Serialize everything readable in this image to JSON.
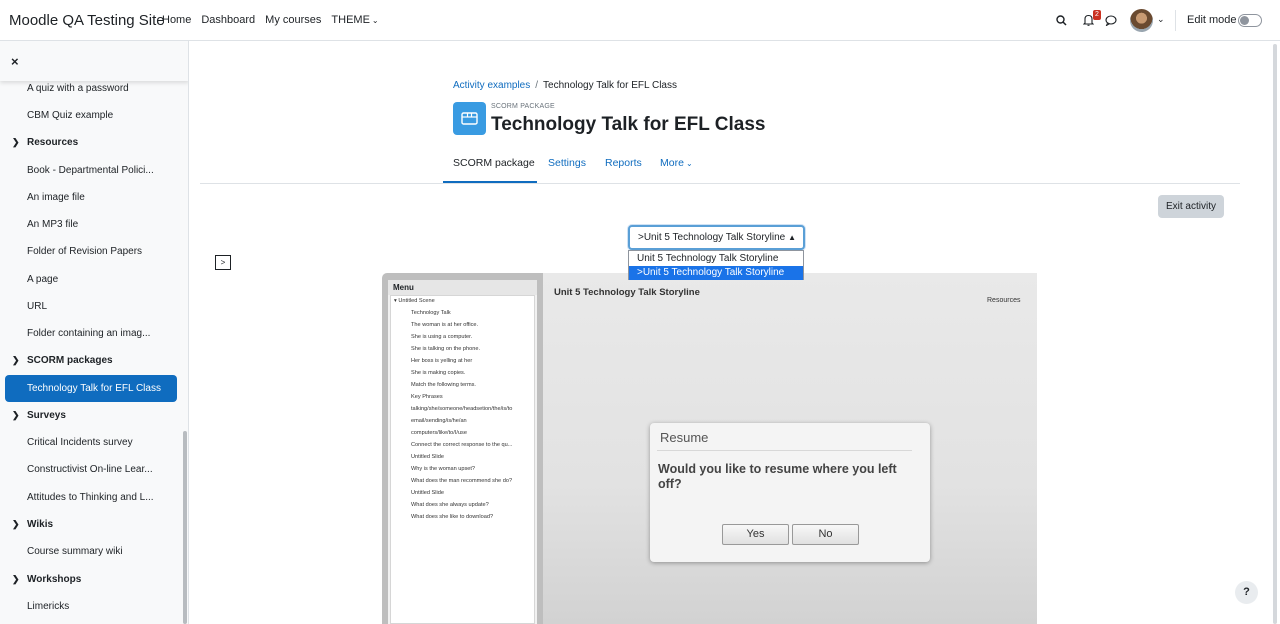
{
  "site": {
    "name": "Moodle QA Testing Site"
  },
  "nav": {
    "home": "Home",
    "dashboard": "Dashboard",
    "my_courses": "My courses",
    "theme": "THEME"
  },
  "header": {
    "notifications_count": "2",
    "edit_mode_label": "Edit mode"
  },
  "sidebar": {
    "close": "×",
    "items": [
      {
        "label": "A quiz with a password"
      },
      {
        "label": "CBM Quiz example"
      },
      {
        "label": "Resources",
        "section": true
      },
      {
        "label": "Book - Departmental Polici..."
      },
      {
        "label": "An image file"
      },
      {
        "label": "An MP3 file"
      },
      {
        "label": "Folder of Revision Papers"
      },
      {
        "label": "A page"
      },
      {
        "label": "URL"
      },
      {
        "label": "Folder containing an imag..."
      },
      {
        "label": "SCORM packages",
        "section": true
      },
      {
        "label": "Technology Talk for EFL Class",
        "active": true
      },
      {
        "label": "Surveys",
        "section": true
      },
      {
        "label": "Critical Incidents survey"
      },
      {
        "label": "Constructivist On-line Lear..."
      },
      {
        "label": "Attitudes to Thinking and L..."
      },
      {
        "label": "Wikis",
        "section": true
      },
      {
        "label": "Course summary wiki"
      },
      {
        "label": "Workshops",
        "section": true
      },
      {
        "label": "Limericks"
      }
    ]
  },
  "breadcrumb": {
    "parent": "Activity examples",
    "current": "Technology Talk for EFL Class"
  },
  "page": {
    "module_type": "SCORM PACKAGE",
    "title": "Technology Talk for EFL Class"
  },
  "tabs": [
    {
      "label": "SCORM package",
      "active": true
    },
    {
      "label": "Settings"
    },
    {
      "label": "Reports"
    },
    {
      "label": "More"
    }
  ],
  "exit_button": "Exit activity",
  "toc_toggle": ">",
  "sco_select": {
    "value": ">Unit 5 Technology Talk Storyline",
    "options": [
      "Unit 5 Technology Talk Storyline",
      ">Unit 5 Technology Talk Storyline"
    ],
    "selected_index": 1
  },
  "player": {
    "menu_title": "Menu",
    "scene": "Untitled Scene",
    "menu_items": [
      "Technology Talk",
      "The woman is at her office.",
      "She is using a computer.",
      "She is talking on the phone.",
      "Her boss is yelling at her",
      "She is making copies.",
      "Match the following terms.",
      "Key Phrases",
      "talking/she/someone/headsetion/the/is/to",
      "email/sending/is/he/an",
      "computers/like/to/I/use",
      "Connect the correct response to the qu...",
      "Untitled Slide",
      "Why is the woman upset?",
      "What does the man recommend she do?",
      "Untitled Slide",
      "What does she always update?",
      "What does she like to download?"
    ],
    "slide_title": "Unit 5 Technology Talk Storyline",
    "resources": "Resources"
  },
  "dialog": {
    "title": "Resume",
    "question": "Would you like to resume where you left off?",
    "yes": "Yes",
    "no": "No"
  },
  "help": "?",
  "colors": {
    "primary": "#0f6cbf",
    "scorm_icon": "#399be2",
    "badge": "#ca3120"
  }
}
